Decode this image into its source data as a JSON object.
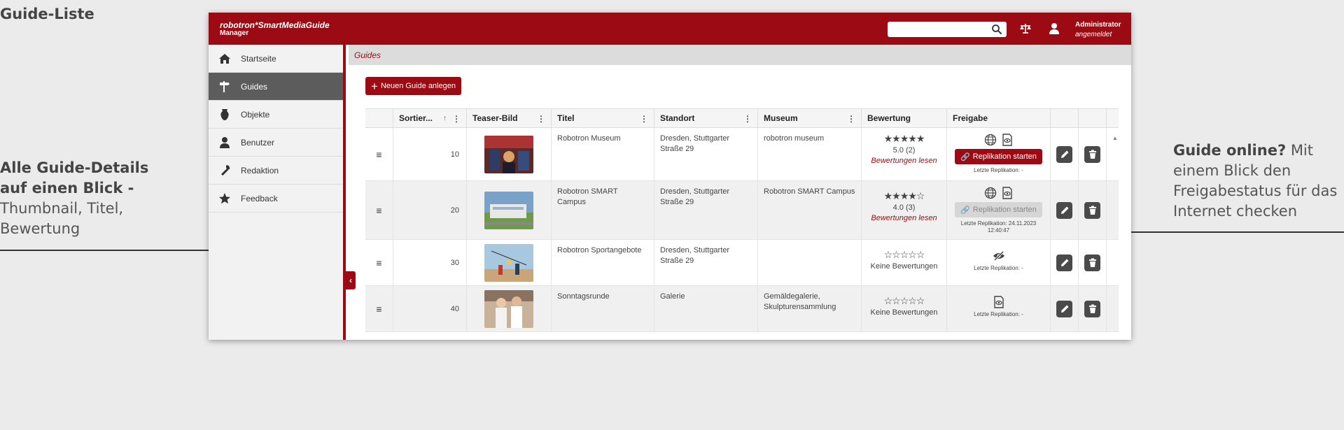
{
  "page": {
    "heading": "Guide-Liste",
    "note_left_bold": "Alle Guide-Details auf einen Blick -",
    "note_left_text": "Thumbnail, Titel, Bewertung",
    "note_right_bold": "Guide online?",
    "note_right_text": "Mit einem Blick den Freigabestatus für das Internet checken"
  },
  "header": {
    "brand": "robotron*SmartMediaGuide",
    "brand_sub": "Manager",
    "user_name": "Administrator",
    "user_status": "angemeldet",
    "search_value": ""
  },
  "sidebar": {
    "items": [
      {
        "label": "Startseite",
        "icon": "home-icon"
      },
      {
        "label": "Guides",
        "icon": "signpost-icon"
      },
      {
        "label": "Objekte",
        "icon": "vase-icon"
      },
      {
        "label": "Benutzer",
        "icon": "user-icon"
      },
      {
        "label": "Redaktion",
        "icon": "wrench-icon"
      },
      {
        "label": "Feedback",
        "icon": "star-icon"
      }
    ],
    "active_index": 1
  },
  "breadcrumb": "Guides",
  "new_button": "Neuen Guide anlegen",
  "table": {
    "columns": [
      "",
      "Sortier...",
      "Teaser-Bild",
      "Titel",
      "Standort",
      "Museum",
      "Bewertung",
      "Freigabe",
      "",
      ""
    ],
    "rows": [
      {
        "sort": "10",
        "title": "Robotron Museum",
        "location": "Dresden, Stuttgarter Straße 29",
        "museum": "robotron museum",
        "stars": "★★★★★",
        "rating": "5.0 (2)",
        "rating_link": "Bewertungen lesen",
        "replication": "Replikation starten",
        "last_replication": "Letzte Replikation: -"
      },
      {
        "sort": "20",
        "title": "Robotron SMART Campus",
        "location": "Dresden, Stuttgarter Straße 29",
        "museum": "Robotron SMART Campus",
        "stars": "★★★★☆",
        "rating": "4.0 (3)",
        "rating_link": "Bewertungen lesen",
        "replication": "Replikation starten",
        "last_replication": "Letzte Replikation: 24.11.2023 12:40:47"
      },
      {
        "sort": "30",
        "title": "Robotron Sportangebote",
        "location": "Dresden, Stuttgarter Straße 29",
        "museum": "",
        "stars": "☆☆☆☆☆",
        "rating": "Keine Bewertungen",
        "rating_link": "",
        "replication": "",
        "last_replication": "Letzte Replikation: -"
      },
      {
        "sort": "40",
        "title": "Sonntagsrunde",
        "location": "Galerie",
        "museum": "Gemäldegalerie, Skulpturensammlung",
        "stars": "☆☆☆☆☆",
        "rating": "Keine Bewertungen",
        "rating_link": "",
        "replication": "",
        "last_replication": "Letzte Replikation: -"
      }
    ]
  },
  "colors": {
    "brand": "#9c0b13",
    "sidebar_active": "#5c5c5c",
    "action_button": "#4a4a4a"
  }
}
